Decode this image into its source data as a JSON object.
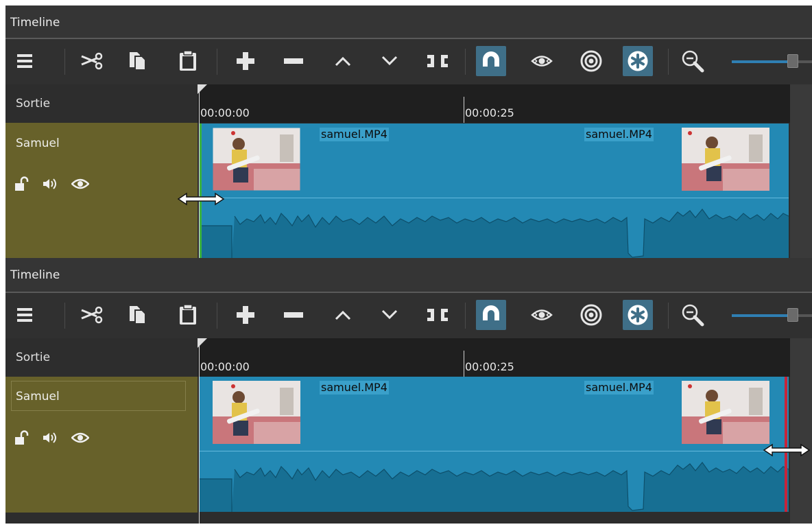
{
  "panels": [
    {
      "title": "Timeline",
      "sortie": "Sortie",
      "track_name": "Samuel",
      "ruler": {
        "start": "00:00:00",
        "mark": "00:00:25"
      },
      "clip": {
        "label_left": "samuel.MP4",
        "label_right": "samuel.MP4"
      },
      "edge": "start-trim"
    },
    {
      "title": "Timeline",
      "sortie": "Sortie",
      "track_name": "Samuel",
      "ruler": {
        "start": "00:00:00",
        "mark": "00:00:25"
      },
      "clip": {
        "label_left": "samuel.MP4",
        "label_right": "samuel.MP4"
      },
      "edge": "end-trim"
    }
  ],
  "toolbar": {
    "buttons": [
      {
        "icon": "menu-icon",
        "active": false
      },
      {
        "icon": "cut-scissors-icon",
        "active": false
      },
      {
        "icon": "copy-icon",
        "active": false
      },
      {
        "icon": "paste-clipboard-icon",
        "active": false
      },
      {
        "icon": "plus-icon",
        "active": false
      },
      {
        "icon": "minus-icon",
        "active": false
      },
      {
        "icon": "chevron-up-icon",
        "active": false
      },
      {
        "icon": "chevron-down-icon",
        "active": false
      },
      {
        "icon": "split-icon",
        "active": false
      },
      {
        "icon": "magnet-snap-icon",
        "active": true
      },
      {
        "icon": "scrub-eye-icon",
        "active": false
      },
      {
        "icon": "ripple-target-icon",
        "active": false
      },
      {
        "icon": "ripple-all-tracks-icon",
        "active": true
      },
      {
        "icon": "zoom-out-icon",
        "active": false
      }
    ],
    "zoom_level": 0.88
  },
  "track_icons": [
    "lock-open-icon",
    "audio-speaker-icon",
    "eye-icon"
  ],
  "colors": {
    "track_header": "#67612a",
    "clip": "#2389b4",
    "active_button": "#3f6f88",
    "in_edge": "#3db33d",
    "out_edge": "#c8243a"
  }
}
